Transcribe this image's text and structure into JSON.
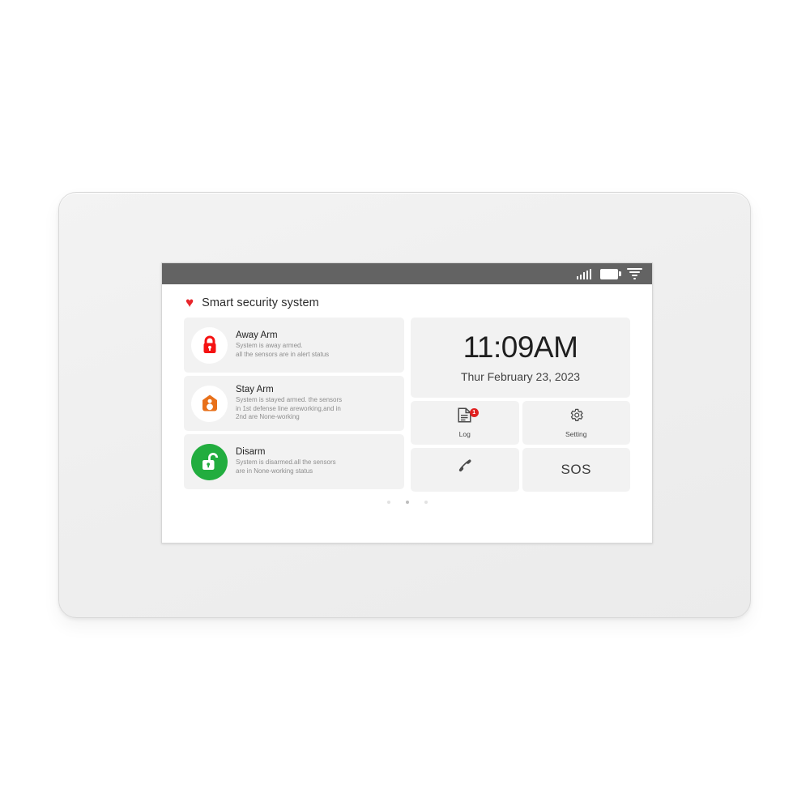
{
  "device": {
    "type": "smart-security-alarm-panel",
    "bezel_color": "#efefef"
  },
  "statusbar": {
    "background": "#636363",
    "icons": [
      "signal-bars-icon",
      "battery-icon",
      "wifi-icon"
    ]
  },
  "header": {
    "heart_glyph": "♥",
    "title": "Smart security system"
  },
  "modes": [
    {
      "name": "Away Arm",
      "description": "System is away armed.\nall the sensors are in alert status",
      "desc_line1": "System is away armed.",
      "desc_line2": "all the sensors are in alert status",
      "icon": "lock-closed-icon",
      "icon_color": "#f51212",
      "circle_color": "#ffffff",
      "active": false
    },
    {
      "name": "Stay Arm",
      "description": "System is stayed armed. the sensors in 1st defense line areworking,and in 2nd are None-working",
      "desc_line1": "System is stayed armed. the sensors",
      "desc_line2": "in 1st defense line areworking,and in",
      "desc_line3": "2nd are None-working",
      "icon": "home-person-icon",
      "icon_color": "#e8701a",
      "circle_color": "#ffffff",
      "active": false
    },
    {
      "name": "Disarm",
      "description": "System is disarmed.all the sensors are in None-working status",
      "desc_line1": "System is disarmed.all the sensors",
      "desc_line2": "are in None-working status",
      "icon": "lock-open-icon",
      "icon_color": "#ffffff",
      "circle_color": "#22ad3f",
      "active": true
    }
  ],
  "clock": {
    "time": "11:09AM",
    "date": "Thur February 23, 2023"
  },
  "tiles": {
    "log": {
      "label": "Log",
      "icon": "document-icon",
      "badge": "1",
      "badge_color": "#e02020"
    },
    "setting": {
      "label": "Setting",
      "icon": "gear-icon"
    },
    "call": {
      "label": "",
      "icon": "phone-handset-icon"
    },
    "sos": {
      "label": "SOS",
      "icon": ""
    }
  },
  "pager": {
    "count": 3,
    "active_index": 1
  }
}
